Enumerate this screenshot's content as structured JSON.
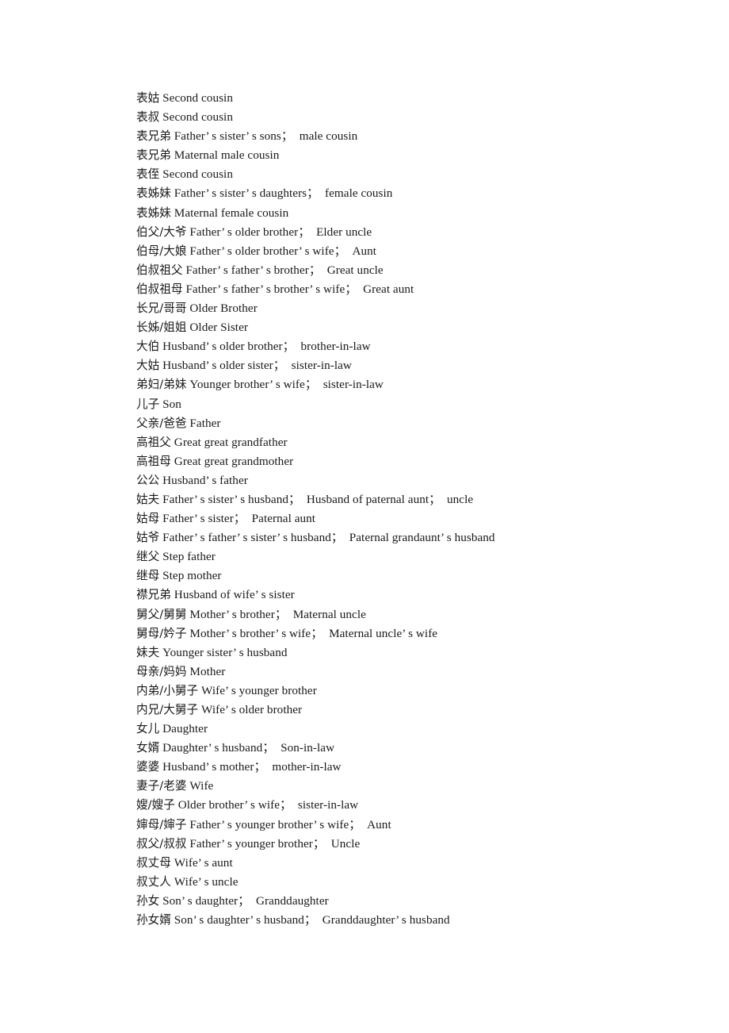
{
  "document": {
    "type": "glossary",
    "language_pair": "Chinese-English",
    "subject": "kinship-terms",
    "background_color": "#ffffff",
    "text_color": "#1a1a1a",
    "entries": [
      {
        "term": "表姑",
        "gloss": "Second cousin"
      },
      {
        "term": "表叔",
        "gloss": "Second cousin"
      },
      {
        "term": "表兄弟",
        "gloss": "Father’ s sister’ s sons；　male cousin"
      },
      {
        "term": "表兄弟",
        "gloss": "Maternal male cousin"
      },
      {
        "term": "表侄",
        "gloss": "Second cousin"
      },
      {
        "term": "表姊妹",
        "gloss": "Father’ s sister’ s daughters；　female cousin"
      },
      {
        "term": "表姊妹",
        "gloss": "Maternal female cousin"
      },
      {
        "term": "伯父/大爷",
        "gloss": "Father’ s older brother；　Elder uncle"
      },
      {
        "term": "伯母/大娘",
        "gloss": "Father’ s older brother’ s wife；　Aunt"
      },
      {
        "term": "伯叔祖父",
        "gloss": "Father’ s father’ s brother；　Great uncle"
      },
      {
        "term": "伯叔祖母",
        "gloss": "Father’ s father’ s brother’ s wife；　Great aunt"
      },
      {
        "term": "长兄/哥哥",
        "gloss": "Older Brother"
      },
      {
        "term": "长姊/姐姐",
        "gloss": "Older Sister"
      },
      {
        "term": "大伯",
        "gloss": "Husband’ s older brother；　brother-in-law"
      },
      {
        "term": "大姑",
        "gloss": "Husband’ s older sister；　sister-in-law"
      },
      {
        "term": "弟妇/弟妹",
        "gloss": "Younger brother’ s wife；　sister-in-law"
      },
      {
        "term": "儿子",
        "gloss": "Son"
      },
      {
        "term": "父亲/爸爸",
        "gloss": "Father"
      },
      {
        "term": "高祖父",
        "gloss": "Great great grandfather"
      },
      {
        "term": "高祖母",
        "gloss": "Great great grandmother"
      },
      {
        "term": "公公",
        "gloss": "Husband’ s father"
      },
      {
        "term": "姑夫",
        "gloss": "Father’ s sister’ s husband；　Husband of paternal aunt；　uncle"
      },
      {
        "term": "姑母",
        "gloss": "Father’ s sister；　Paternal aunt"
      },
      {
        "term": "姑爷",
        "gloss": "Father’ s father’ s sister’ s husband；　Paternal grandaunt’ s husband"
      },
      {
        "term": "继父",
        "gloss": "Step father"
      },
      {
        "term": "继母",
        "gloss": "Step mother"
      },
      {
        "term": "襟兄弟",
        "gloss": "Husband of wife’ s sister"
      },
      {
        "term": "舅父/舅舅",
        "gloss": "Mother’ s brother；　Maternal uncle"
      },
      {
        "term": "舅母/妗子",
        "gloss": "Mother’ s brother’ s wife；　Maternal uncle’ s wife"
      },
      {
        "term": "妹夫",
        "gloss": "Younger sister’ s husband"
      },
      {
        "term": "母亲/妈妈",
        "gloss": "Mother"
      },
      {
        "term": "内弟/小舅子",
        "gloss": "Wife’ s younger brother"
      },
      {
        "term": "内兄/大舅子",
        "gloss": "Wife’ s older brother"
      },
      {
        "term": "女儿",
        "gloss": "Daughter"
      },
      {
        "term": "女婿",
        "gloss": "Daughter’ s husband；　Son-in-law"
      },
      {
        "term": "婆婆",
        "gloss": "Husband’ s mother；　mother-in-law"
      },
      {
        "term": "妻子/老婆",
        "gloss": "Wife"
      },
      {
        "term": "嫂/嫂子",
        "gloss": "Older brother’ s wife；　sister-in-law"
      },
      {
        "term": "婶母/婶子",
        "gloss": "Father’ s younger brother’ s wife；　Aunt"
      },
      {
        "term": "叔父/叔叔",
        "gloss": "Father’ s younger brother；　Uncle"
      },
      {
        "term": "叔丈母",
        "gloss": "Wife’ s aunt"
      },
      {
        "term": "叔丈人",
        "gloss": "Wife’ s uncle"
      },
      {
        "term": "孙女",
        "gloss": "Son’ s daughter；　Granddaughter"
      },
      {
        "term": "孙女婿",
        "gloss": "Son’ s daughter’ s husband；　Granddaughter’ s husband"
      }
    ]
  }
}
